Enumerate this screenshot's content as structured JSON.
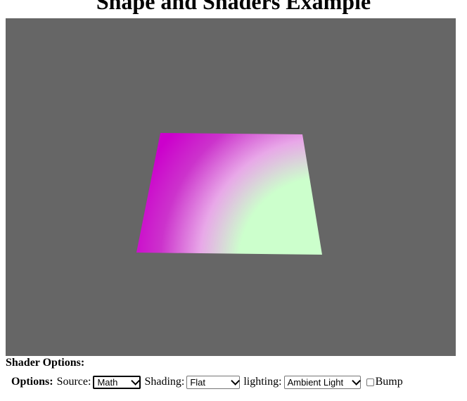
{
  "page": {
    "title": "Shape and Shaders Example"
  },
  "viewport": {
    "background_color": "#666666",
    "quad_colors": {
      "magenta": "#cc00cc",
      "light_green": "#ccffcc"
    }
  },
  "shader_options": {
    "heading": "Shader Options:",
    "options_label": "Options:",
    "source_label": "Source:",
    "source_value": "Math",
    "shading_label": "Shading:",
    "shading_value": "Flat",
    "lighting_label": "lighting:",
    "lighting_value": "Ambient Light",
    "bump_label": "Bump",
    "bump_checked": false
  }
}
